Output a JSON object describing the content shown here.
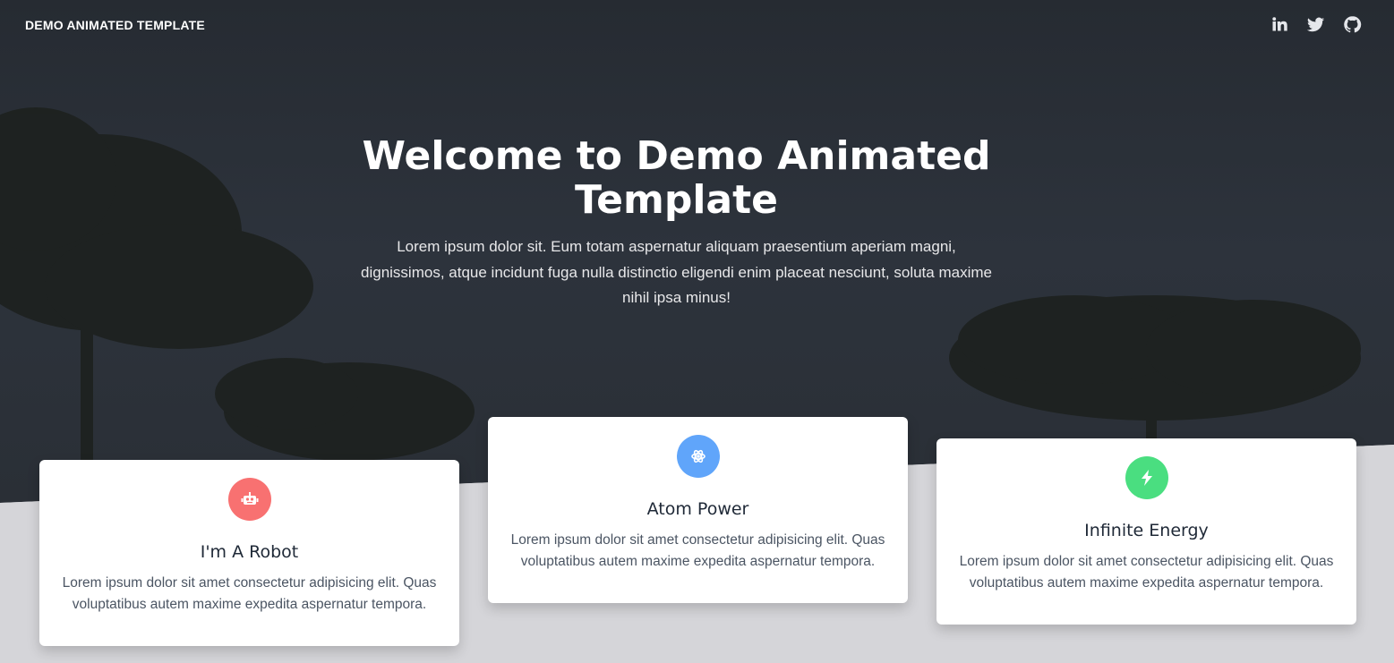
{
  "nav": {
    "brand": "DEMO ANIMATED TEMPLATE",
    "social": [
      "linkedin-icon",
      "twitter-icon",
      "github-icon"
    ]
  },
  "hero": {
    "title": "Welcome to Demo Animated Template",
    "subtitle": "Lorem ipsum dolor sit. Eum totam aspernatur aliquam praesentium aperiam magni, dignissimos, atque incidunt fuga nulla distinctio eligendi enim placeat nesciunt, soluta maxime nihil ipsa minus!"
  },
  "cards": [
    {
      "icon": "robot-icon",
      "color": "#f87171",
      "title": "I'm A Robot",
      "text": "Lorem ipsum dolor sit amet consectetur adipisicing elit. Quas voluptatibus autem maxime expedita aspernatur tempora."
    },
    {
      "icon": "atom-icon",
      "color": "#60a5fa",
      "title": "Atom Power",
      "text": "Lorem ipsum dolor sit amet consectetur adipisicing elit. Quas voluptatibus autem maxime expedita aspernatur tempora."
    },
    {
      "icon": "bolt-icon",
      "color": "#4ade80",
      "title": "Infinite Energy",
      "text": "Lorem ipsum dolor sit amet consectetur adipisicing elit. Quas voluptatibus autem maxime expedita aspernatur tempora."
    }
  ],
  "colors": {
    "hero_dark": "#2c323b",
    "page_bg": "#d5d5d9"
  }
}
